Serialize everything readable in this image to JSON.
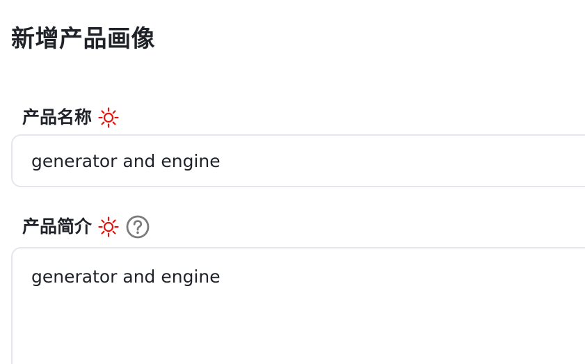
{
  "page": {
    "title": "新增产品画像"
  },
  "form": {
    "product_name": {
      "label": "产品名称",
      "value": "generator and engine",
      "required_icon": "sun-asterisk-icon"
    },
    "product_description": {
      "label": "产品简介",
      "value": "generator and engine",
      "required_icon": "sun-asterisk-icon",
      "help_icon": "question-circle-icon"
    }
  },
  "colors": {
    "required": "#e8120c",
    "help": "#7b7b7b",
    "border": "#e5e6eb",
    "text": "#1f2329"
  }
}
